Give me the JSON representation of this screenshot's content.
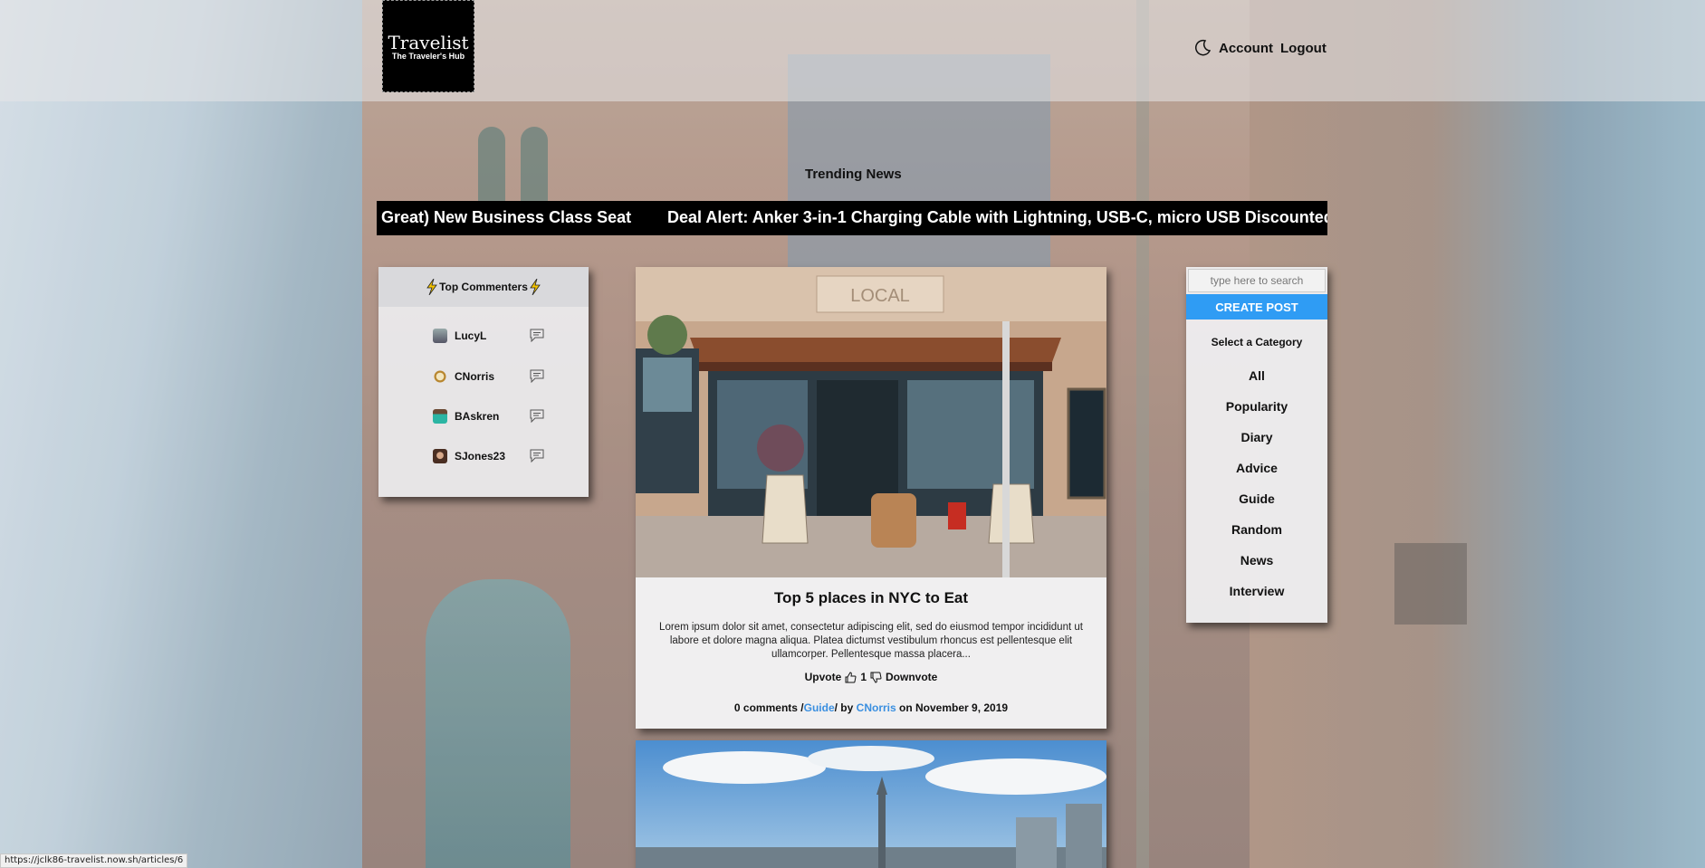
{
  "header": {
    "logo_title": "Travelist",
    "logo_subtitle": "The Traveler's Hub",
    "nav": {
      "theme_icon": "moon-icon",
      "account_label": "Account",
      "logout_label": "Logout"
    }
  },
  "trending": {
    "title": "Trending News",
    "items": [
      "Great) New Business Class Seat",
      "Deal Alert: Anker 3-in-1 Charging Cable with Lightning, USB-C, micro USB Discounted t"
    ]
  },
  "top_commenters": {
    "title": "Top Commenters",
    "items": [
      {
        "name": "LucyL"
      },
      {
        "name": "CNorris"
      },
      {
        "name": "BAskren"
      },
      {
        "name": "SJones23"
      }
    ]
  },
  "post": {
    "title": "Top 5 places in NYC to Eat",
    "excerpt": "Lorem ipsum dolor sit amet, consectetur adipiscing elit, sed do eiusmod tempor incididunt ut labore et dolore magna aliqua. Platea dictumst vestibulum rhoncus est pellentesque elit ullamcorper. Pellentesque massa placera...",
    "upvote_label": "Upvote",
    "vote_count": "1",
    "downvote_label": "Downvote",
    "comments": "0 comments /",
    "category": "Guide",
    "by": "/ by",
    "author": "CNorris",
    "date": "on November 9, 2019",
    "photo_sign": "LOCAL"
  },
  "sidebar": {
    "search_placeholder": "type here to search",
    "create_post_label": "CREATE POST",
    "category_heading": "Select a Category",
    "categories": [
      "All",
      "Popularity",
      "Diary",
      "Advice",
      "Guide",
      "Random",
      "News",
      "Interview"
    ]
  },
  "status_bar": {
    "url": "https://jclk86-travelist.now.sh/articles/6"
  },
  "colors": {
    "accent": "#2f9cf4",
    "link": "#3a8fe0",
    "logo_bg": "#000000"
  }
}
